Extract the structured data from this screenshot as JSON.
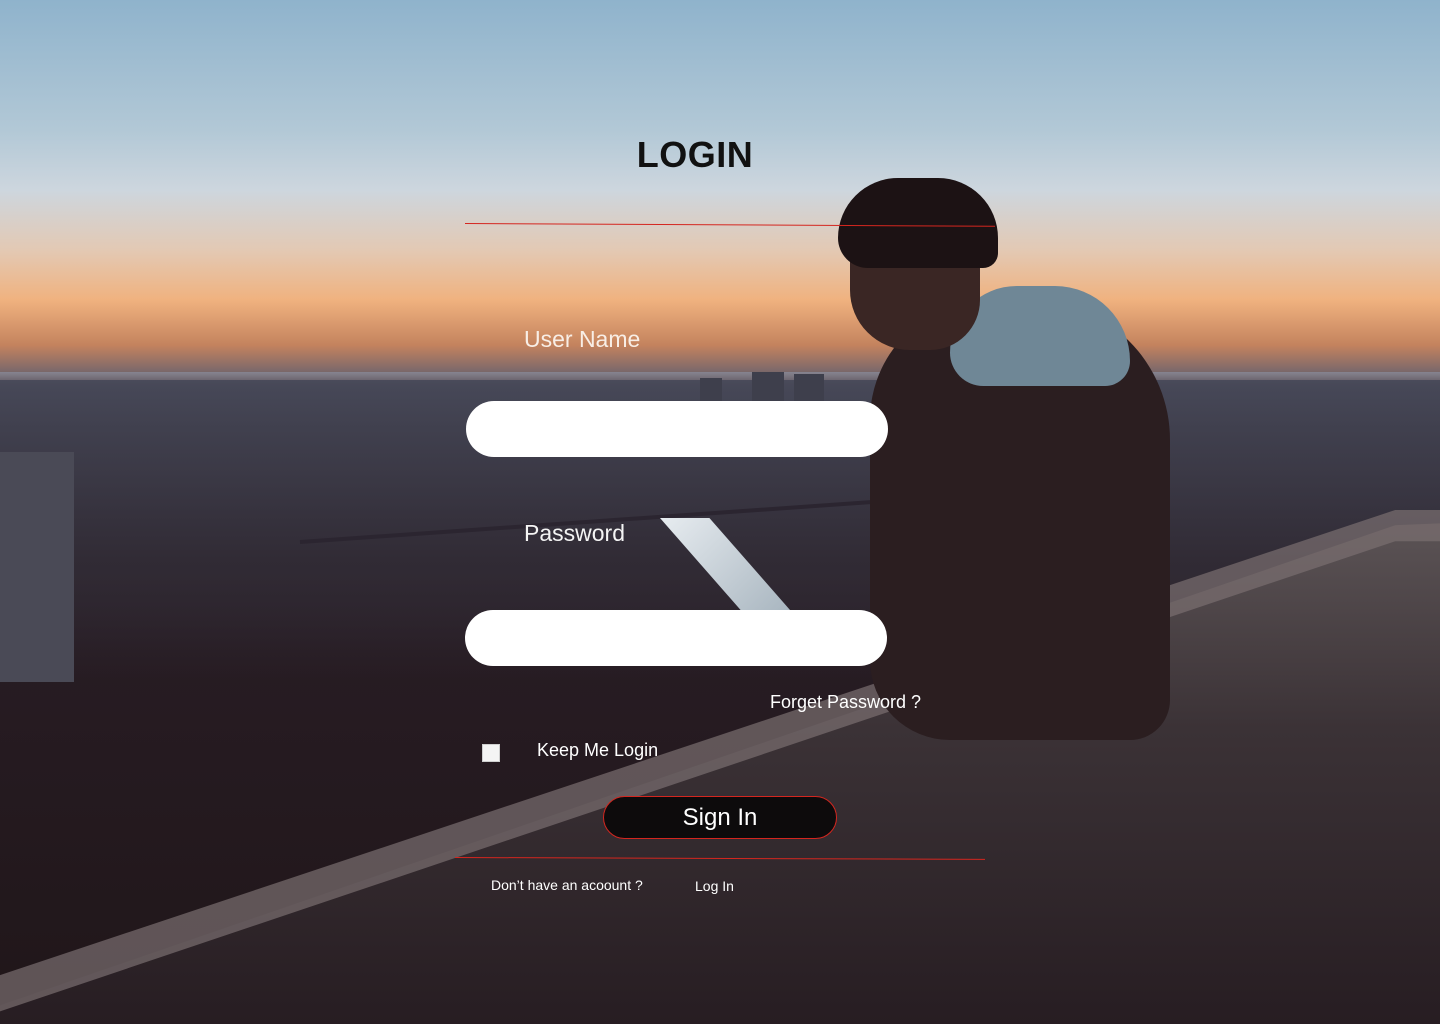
{
  "form": {
    "title": "LOGIN",
    "username_label": "User Name",
    "username_value": "",
    "password_label": "Password",
    "password_value": "",
    "forgot_password": "Forget Password ?",
    "keep_login_label": "Keep Me Login",
    "keep_login_checked": false,
    "signin_label": "Sign In",
    "no_account_text": "Don’t have an acoount ?",
    "login_link": "Log In"
  },
  "colors": {
    "accent": "#d4261f",
    "button_bg": "#0d0b0c",
    "input_bg": "#ffffff",
    "text": "#ffffff",
    "title": "#111111"
  },
  "background": {
    "description_icon": "dusk-city-photo"
  }
}
